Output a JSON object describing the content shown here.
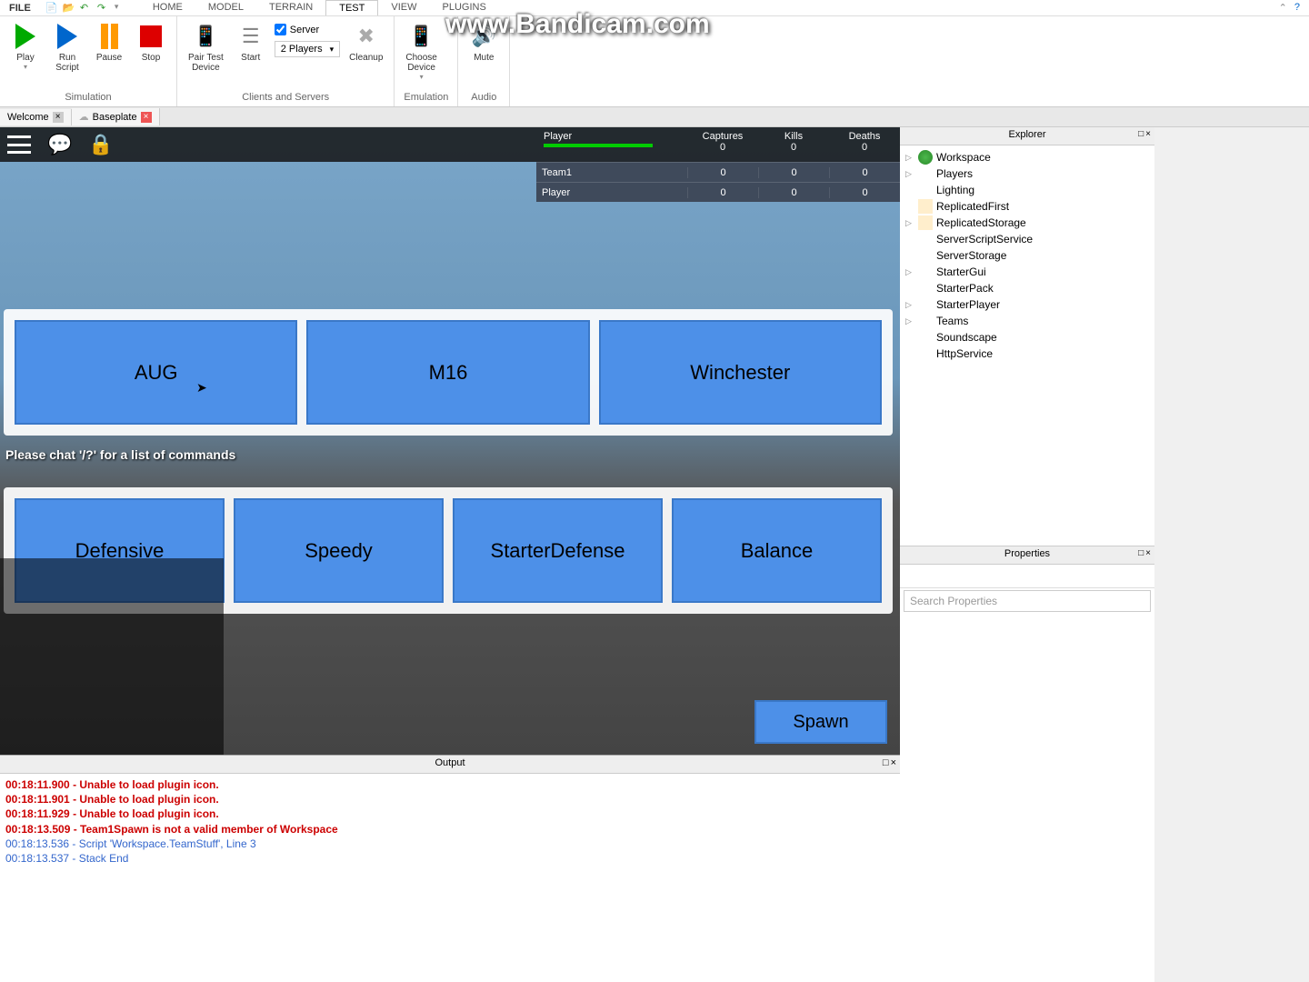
{
  "watermark": "www.Bandicam.com",
  "menu": {
    "file": "FILE",
    "tabs": [
      "HOME",
      "MODEL",
      "TERRAIN",
      "TEST",
      "VIEW",
      "PLUGINS"
    ],
    "active_tab": "TEST"
  },
  "ribbon": {
    "sim": {
      "play": "Play",
      "run": "Run\nScript",
      "pause": "Pause",
      "stop": "Stop",
      "label": "Simulation"
    },
    "clients": {
      "pairtest": "Pair Test\nDevice",
      "start": "Start",
      "server_chk": "Server",
      "players_sel": "2 Players",
      "cleanup": "Cleanup",
      "label": "Clients and Servers"
    },
    "emu": {
      "choose": "Choose\nDevice",
      "label": "Emulation"
    },
    "audio": {
      "mute": "Mute",
      "label": "Audio"
    }
  },
  "doctabs": {
    "welcome": "Welcome",
    "baseplate": "Baseplate"
  },
  "scoreboard": {
    "player": "Player",
    "cols": [
      "Captures",
      "Kills",
      "Deaths"
    ],
    "header_vals": [
      "0",
      "0",
      "0"
    ],
    "rows": [
      {
        "name": "Team1",
        "vals": [
          "0",
          "0",
          "0"
        ]
      },
      {
        "name": "Player",
        "vals": [
          "0",
          "0",
          "0"
        ]
      }
    ]
  },
  "game": {
    "weapons": [
      "AUG",
      "M16",
      "Winchester"
    ],
    "classes": [
      "Defensive",
      "Speedy",
      "StarterDefense",
      "Balance"
    ],
    "chat_hint": "Please chat '/?' for a list of commands",
    "spawn": "Spawn"
  },
  "explorer": {
    "title": "Explorer",
    "items": [
      {
        "name": "Workspace",
        "ico": "ico-globe",
        "expand": true
      },
      {
        "name": "Players",
        "ico": "ico-players",
        "expand": true
      },
      {
        "name": "Lighting",
        "ico": "ico-light",
        "expand": false
      },
      {
        "name": "ReplicatedFirst",
        "ico": "ico-box",
        "expand": false
      },
      {
        "name": "ReplicatedStorage",
        "ico": "ico-box",
        "expand": true
      },
      {
        "name": "ServerScriptService",
        "ico": "ico-cloud",
        "expand": false
      },
      {
        "name": "ServerStorage",
        "ico": "ico-cloud",
        "expand": false
      },
      {
        "name": "StarterGui",
        "ico": "ico-folder",
        "expand": true
      },
      {
        "name": "StarterPack",
        "ico": "ico-folder",
        "expand": false
      },
      {
        "name": "StarterPlayer",
        "ico": "ico-folder",
        "expand": true
      },
      {
        "name": "Teams",
        "ico": "ico-team",
        "expand": true
      },
      {
        "name": "Soundscape",
        "ico": "ico-sound",
        "expand": false
      },
      {
        "name": "HttpService",
        "ico": "ico-http",
        "expand": false
      }
    ]
  },
  "properties": {
    "title": "Properties",
    "search_ph": "Search Properties"
  },
  "output": {
    "title": "Output",
    "lines": [
      {
        "cls": "out-red",
        "text": "00:18:11.900 - Unable to load plugin icon."
      },
      {
        "cls": "out-red",
        "text": "00:18:11.901 - Unable to load plugin icon."
      },
      {
        "cls": "out-red",
        "text": "00:18:11.929 - Unable to load plugin icon."
      },
      {
        "cls": "out-red",
        "text": "00:18:13.509 - Team1Spawn is not a valid member of Workspace"
      },
      {
        "cls": "out-blue",
        "text": "00:18:13.536 - Script 'Workspace.TeamStuff', Line 3"
      },
      {
        "cls": "out-blue",
        "text": "00:18:13.537 - Stack End"
      }
    ]
  }
}
